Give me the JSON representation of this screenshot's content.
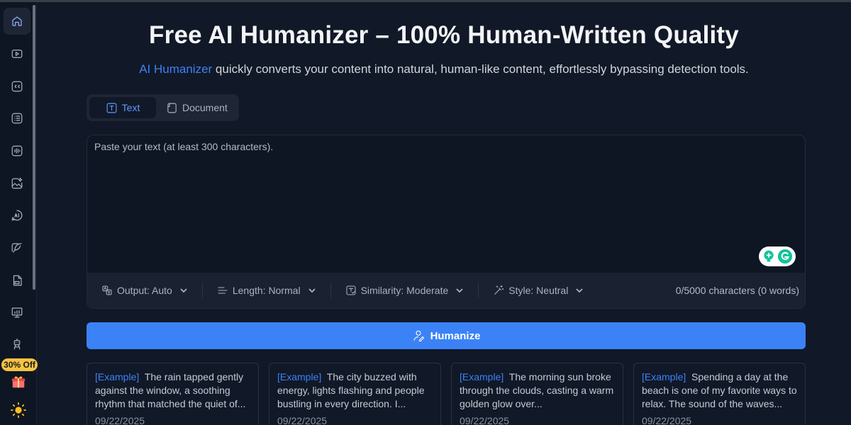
{
  "header": {
    "title": "Free AI Humanizer – 100% Human-Written Quality",
    "subtitle_link": "AI Humanizer",
    "subtitle_rest": " quickly converts your content into natural, human-like content, effortlessly bypassing detection tools."
  },
  "tabs": [
    {
      "label": "Text",
      "icon": "text-icon",
      "active": true
    },
    {
      "label": "Document",
      "icon": "document-icon",
      "active": false
    }
  ],
  "editor": {
    "placeholder": "Paste your text (at least 300 characters).",
    "value": ""
  },
  "toolbar": {
    "output": "Output: Auto",
    "length": "Length: Normal",
    "similarity": "Similarity: Moderate",
    "style": "Style: Neutral",
    "counter": "0/5000 characters (0 words)"
  },
  "humanize_label": "Humanize",
  "promo": "30% Off",
  "examples": [
    {
      "tag": "[Example]",
      "text": "The rain tapped gently against the window, a soothing rhythm that matched the quiet of...",
      "date": "09/22/2025"
    },
    {
      "tag": "[Example]",
      "text": "The city buzzed with energy, lights flashing and people bustling in every direction. I...",
      "date": "09/22/2025"
    },
    {
      "tag": "[Example]",
      "text": "The morning sun broke through the clouds, casting a warm golden glow over...",
      "date": "09/22/2025"
    },
    {
      "tag": "[Example]",
      "text": "Spending a day at the beach is one of my favorite ways to relax. The sound of the waves...",
      "date": "09/22/2025"
    }
  ],
  "sidebar": {
    "items": [
      "home-icon",
      "video-icon",
      "captions-icon",
      "list-icon",
      "audio-wave-icon",
      "image-edit-icon",
      "ai-chat-icon",
      "pen-icon",
      "pdf-icon",
      "presentation-icon",
      "robot-icon"
    ]
  },
  "colors": {
    "accent": "#3b82f6",
    "background": "#111827",
    "promo": "#f6c343"
  }
}
